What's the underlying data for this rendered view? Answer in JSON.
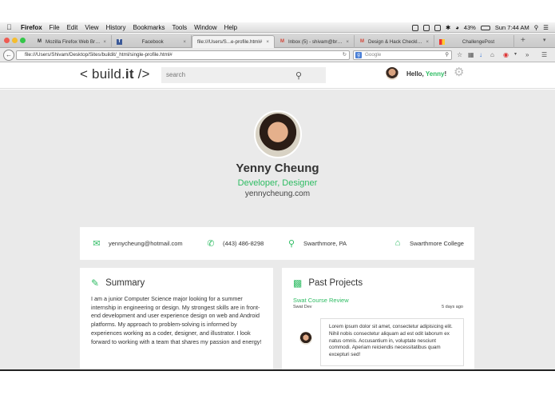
{
  "menubar": {
    "app": "Firefox",
    "items": [
      "File",
      "Edit",
      "View",
      "History",
      "Bookmarks",
      "Tools",
      "Window",
      "Help"
    ],
    "battery": "43%",
    "clock": "Sun 7:44 AM"
  },
  "tabs": [
    {
      "icon": "M",
      "title": "Mozilla Firefox Web Brows..."
    },
    {
      "icon": "f",
      "title": "Facebook"
    },
    {
      "icon": "",
      "title": "file:///Users/S...e-profile.html#"
    },
    {
      "icon": "M",
      "title": "Inbox (5) - shivam@briga..."
    },
    {
      "icon": "M",
      "title": "Design & Hack Checklist (..."
    },
    {
      "icon": "",
      "title": "ChallengePost"
    }
  ],
  "navbar": {
    "url": "file:///Users/Shivam/Desktop/Sites/buildit/_html/single-profile.html#",
    "search_placeholder": "Google"
  },
  "site": {
    "logo_pre": "< build.",
    "logo_bold": "it",
    "logo_post": " />",
    "search_placeholder": "search",
    "hello_prefix": "Hello, ",
    "hello_name": "Yenny",
    "hello_suffix": "!"
  },
  "profile": {
    "name": "Yenny Cheung",
    "role": "Developer, Designer",
    "website": "yennycheung.com"
  },
  "contact": {
    "email": "yennycheung@hotmail.com",
    "phone": "(443) 486-8298",
    "location": "Swarthmore, PA",
    "school": "Swarthmore College"
  },
  "summary": {
    "title": "Summary",
    "text": "I am a junior Computer Science major looking for a summer internship in engineering or design. My strongest skills are in front-end development and user experience design on web and Android platforms. My approach to problem-solving is informed by experiences working as a coder, designer, and illustrator. I look forward to working with a team that shares my passion and energy!"
  },
  "projects": {
    "title": "Past Projects",
    "items": [
      {
        "name": "Swat Course Review",
        "subtitle": "Swat Dev",
        "time": "5 days ago",
        "comment": "Lorem ipsum dolor sit amet, consectetur adipisicing elit. Nihil nobis consectetur aliquam ad est odit laborum ex natus omnis. Accusantium in, voluptate nesciunt commodi. Aperiam reiciendis necessitatibus quam excepturi sed!"
      }
    ]
  },
  "colors": {
    "accent": "#2ebc63"
  }
}
